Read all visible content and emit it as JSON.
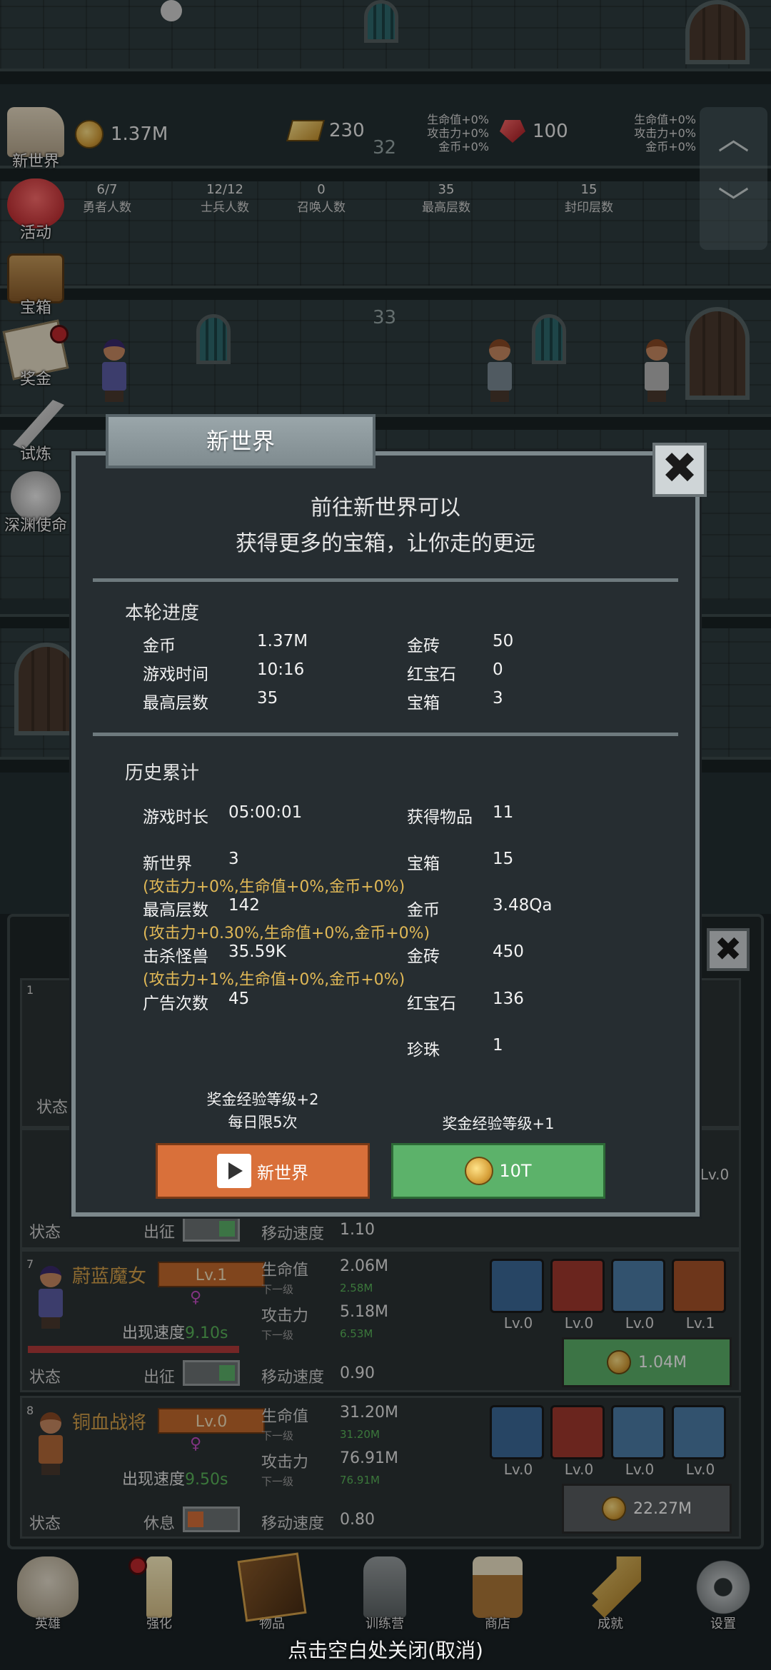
{
  "topbar": {
    "gold": "1.37M",
    "goldbar": "230",
    "ruby": "100",
    "floor_top": "32",
    "bonus_a": [
      "生命值+0%",
      "攻击力+0%",
      "金币+0%"
    ],
    "bonus_b": [
      "生命值+0%",
      "攻击力+0%",
      "金币+0%"
    ],
    "stats": [
      {
        "value": "6/7",
        "label": "勇者人数"
      },
      {
        "value": "12/12",
        "label": "士兵人数"
      },
      {
        "value": "0",
        "label": "召唤人数"
      },
      {
        "value": "35",
        "label": "最高层数"
      },
      {
        "value": "15",
        "label": "封印层数"
      }
    ]
  },
  "scene": {
    "floor_mid": "33"
  },
  "sidemenu": [
    "新世界",
    "活动",
    "宝箱",
    "奖金",
    "试炼",
    "深渊使命"
  ],
  "dialog": {
    "title": "新世界",
    "headline_1": "前往新世界可以",
    "headline_2": "获得更多的宝箱，让你走的更远",
    "round_title": "本轮进度",
    "round": [
      {
        "k": "金币",
        "v": "1.37M"
      },
      {
        "k": "金砖",
        "v": "50"
      },
      {
        "k": "游戏时间",
        "v": "10:16"
      },
      {
        "k": "红宝石",
        "v": "0"
      },
      {
        "k": "最高层数",
        "v": "35"
      },
      {
        "k": "宝箱",
        "v": "3"
      }
    ],
    "history_title": "历史累计",
    "history": {
      "playtime_k": "游戏时长",
      "playtime_v": "05:00:01",
      "items_k": "获得物品",
      "items_v": "11",
      "newworld_k": "新世界",
      "newworld_v": "3",
      "chest_k": "宝箱",
      "chest_v": "15",
      "note_1": "(攻击力+0%,生命值+0%,金币+0%)",
      "maxfloor_k": "最高层数",
      "maxfloor_v": "142",
      "gold_k": "金币",
      "gold_v": "3.48Qa",
      "note_2": "(攻击力+0.30%,生命值+0%,金币+0%)",
      "kills_k": "击杀怪兽",
      "kills_v": "35.59K",
      "goldbar_k": "金砖",
      "goldbar_v": "450",
      "note_3": "(攻击力+1%,生命值+0%,金币+0%)",
      "ads_k": "广告次数",
      "ads_v": "45",
      "ruby_k": "红宝石",
      "ruby_v": "136",
      "pearl_k": "珍珠",
      "pearl_v": "1"
    },
    "left_caption_1": "奖金经验等级+2",
    "left_caption_2": "每日限5次",
    "right_caption": "奖金经验等级+1",
    "btn_video_label": "新世界",
    "btn_gold_label": "10T"
  },
  "herolist": {
    "row1_index": "1",
    "status_label": "状态",
    "row2": {
      "status": "状态",
      "action": "出征",
      "move_label": "移动速度",
      "move": "1.10"
    },
    "row7": {
      "index": "7",
      "name": "蔚蓝魔女",
      "lv": "Lv.1",
      "speed_label": "出现速度",
      "speed": "9.10s",
      "hp_label": "生命值",
      "hp": "2.06M",
      "hp_next_label": "下一级",
      "hp_next": "2.58M",
      "atk_label": "攻击力",
      "atk": "5.18M",
      "atk_next_label": "下一级",
      "atk_next": "6.53M",
      "move_label": "移动速度",
      "move": "0.90",
      "status": "状态",
      "action": "出征",
      "skills": [
        "Lv.0",
        "Lv.0",
        "Lv.0",
        "Lv.1"
      ],
      "cost": "1.04M"
    },
    "row8": {
      "index": "8",
      "name": "铜血战将",
      "lv": "Lv.0",
      "speed_label": "出现速度",
      "speed": "9.50s",
      "hp_label": "生命值",
      "hp": "31.20M",
      "hp_next_label": "下一级",
      "hp_next": "31.20M",
      "atk_label": "攻击力",
      "atk": "76.91M",
      "atk_next_label": "下一级",
      "atk_next": "76.91M",
      "move_label": "移动速度",
      "move": "0.80",
      "status": "状态",
      "action": "休息",
      "skills": [
        "Lv.0",
        "Lv.0",
        "Lv.0",
        "Lv.0"
      ],
      "cost": "22.27M"
    },
    "skill_lv_row2": "Lv.0"
  },
  "nav": [
    "英雄",
    "强化",
    "物品",
    "训练营",
    "商店",
    "成就",
    "设置"
  ],
  "footer_hint": "点击空白处关闭(取消)",
  "colors": {
    "orange_button": "#d9703a",
    "green_button": "#5cb26a",
    "note_gold": "#e0b856",
    "speed_green": "#5bb75b"
  }
}
